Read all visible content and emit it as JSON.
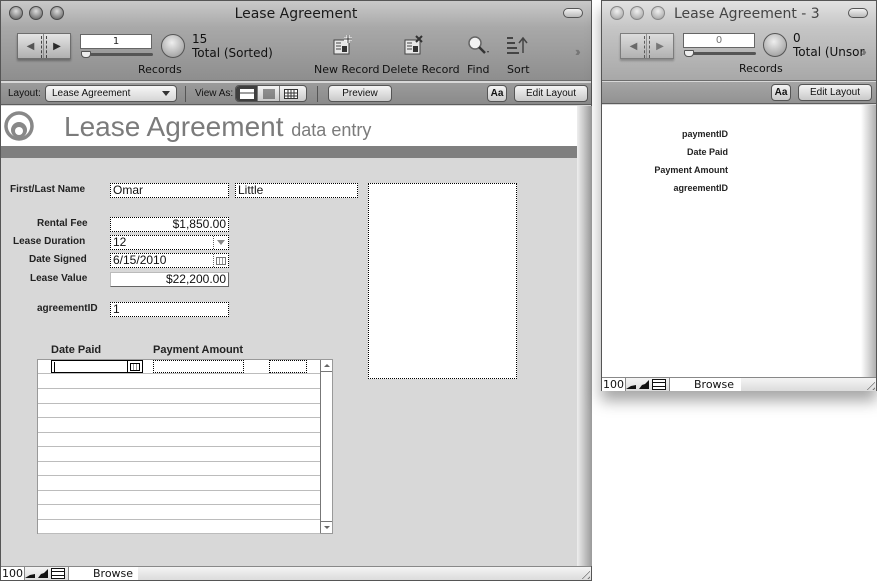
{
  "main_window": {
    "title": "Lease Agreement",
    "toolbar": {
      "record_number": "1",
      "record_count": "15",
      "record_status": "Total (Sorted)",
      "records_label": "Records",
      "buttons": [
        {
          "label": "New Record",
          "icon": "new-record-icon"
        },
        {
          "label": "Delete Record",
          "icon": "delete-record-icon"
        },
        {
          "label": "Find",
          "icon": "find-icon"
        },
        {
          "label": "Sort",
          "icon": "sort-icon"
        }
      ],
      "overflow_icon": "chevron-double-right-icon"
    },
    "layout_bar": {
      "layout_label": "Layout:",
      "layout_value": "Lease Agreement",
      "view_as_label": "View As:",
      "view_modes": [
        "form",
        "list",
        "table"
      ],
      "view_mode_selected": "form",
      "preview_label": "Preview",
      "text_format_label": "Aa",
      "edit_layout_label": "Edit Layout"
    },
    "header": {
      "title": "Lease Agreement",
      "subtitle": "data entry"
    },
    "form": {
      "name_label": "First/Last Name",
      "first_name": "Omar",
      "last_name": "Little",
      "rental_fee_label": "Rental Fee",
      "rental_fee": "$1,850.00",
      "lease_duration_label": "Lease Duration",
      "lease_duration": "12",
      "date_signed_label": "Date Signed",
      "date_signed": "6/15/2010",
      "lease_value_label": "Lease Value",
      "lease_value": "$22,200.00",
      "agreement_id_label": "agreementID",
      "agreement_id": "1"
    },
    "portal": {
      "columns": [
        "Date Paid",
        "Payment Amount"
      ],
      "rows": [
        {
          "date_paid": "",
          "payment_amount": "",
          "extra": ""
        }
      ],
      "empty_row_count": 11
    },
    "status_bar": {
      "zoom": "100",
      "mode": "Browse"
    }
  },
  "second_window": {
    "title": "Lease Agreement - 3",
    "toolbar": {
      "record_number": "0",
      "record_count": "0",
      "record_status": "Total (Unsor",
      "records_label": "Records"
    },
    "layout_bar": {
      "text_format_label": "Aa",
      "edit_layout_label": "Edit Layout"
    },
    "fields": [
      "paymentID",
      "Date Paid",
      "Payment Amount",
      "agreementID"
    ],
    "status_bar": {
      "zoom": "100",
      "mode": "Browse"
    }
  }
}
